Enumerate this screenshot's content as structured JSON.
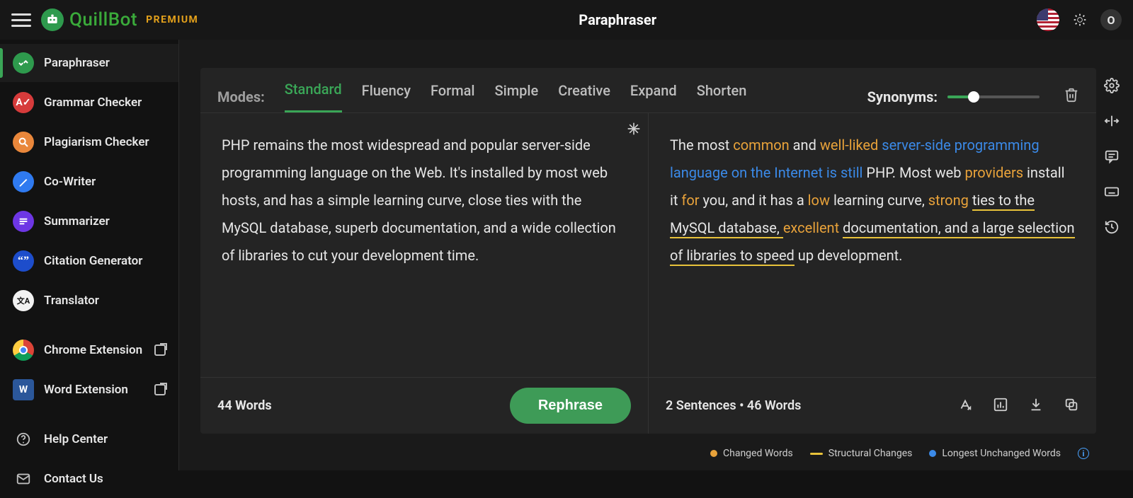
{
  "header": {
    "brand_name": "QuillBot",
    "brand_premium": "PREMIUM",
    "title": "Paraphraser",
    "avatar_letter": "O"
  },
  "sidebar": {
    "main_items": [
      {
        "id": "paraphraser",
        "label": "Paraphraser",
        "active": true
      },
      {
        "id": "grammar-checker",
        "label": "Grammar Checker",
        "active": false
      },
      {
        "id": "plagiarism-checker",
        "label": "Plagiarism Checker",
        "active": false
      },
      {
        "id": "co-writer",
        "label": "Co-Writer",
        "active": false
      },
      {
        "id": "summarizer",
        "label": "Summarizer",
        "active": false
      },
      {
        "id": "citation-generator",
        "label": "Citation Generator",
        "active": false
      },
      {
        "id": "translator",
        "label": "Translator",
        "active": false
      }
    ],
    "ext_items": [
      {
        "id": "chrome-ext",
        "label": "Chrome Extension"
      },
      {
        "id": "word-ext",
        "label": "Word Extension"
      }
    ],
    "footer_items": [
      {
        "id": "help-center",
        "label": "Help Center"
      },
      {
        "id": "contact-us",
        "label": "Contact Us"
      }
    ]
  },
  "modes": {
    "label": "Modes:",
    "items": [
      "Standard",
      "Fluency",
      "Formal",
      "Simple",
      "Creative",
      "Expand",
      "Shorten"
    ],
    "active_index": 0,
    "synonyms_label": "Synonyms:"
  },
  "input": {
    "text": "PHP remains the most widespread and popular server-side programming language on the Web. It's installed by most web hosts, and has a simple learning curve, close ties with the MySQL database, superb documentation, and a wide collection of libraries to cut your development time.",
    "word_count": "44 Words"
  },
  "output": {
    "tokens": [
      {
        "t": "The most ",
        "c": "plain"
      },
      {
        "t": "common",
        "c": "changed"
      },
      {
        "t": " and ",
        "c": "plain"
      },
      {
        "t": "well-liked",
        "c": "changed"
      },
      {
        "t": " ",
        "c": "plain"
      },
      {
        "t": "server-side programming language on the Internet is still",
        "c": "longest"
      },
      {
        "t": " PHP. Most web ",
        "c": "plain"
      },
      {
        "t": "providers",
        "c": "changed"
      },
      {
        "t": " install it ",
        "c": "plain"
      },
      {
        "t": "for",
        "c": "changed"
      },
      {
        "t": " you, and it has a ",
        "c": "plain"
      },
      {
        "t": "low",
        "c": "changed"
      },
      {
        "t": " learning curve, ",
        "c": "plain"
      },
      {
        "t": "strong",
        "c": "changed"
      },
      {
        "t": " ",
        "c": "plain"
      },
      {
        "t": "ties to the MySQL database, ",
        "c": "struct"
      },
      {
        "t": "excellent",
        "c": "changed"
      },
      {
        "t": " ",
        "c": "plain"
      },
      {
        "t": "documentation, and a ",
        "c": "struct"
      },
      {
        "t": "large selection",
        "c": "changed-struct"
      },
      {
        "t": " ",
        "c": "plain"
      },
      {
        "t": "of libraries to ",
        "c": "struct"
      },
      {
        "t": "speed",
        "c": "changed-struct"
      },
      {
        "t": " up development.",
        "c": "plain"
      }
    ],
    "stats": "2 Sentences  •  46 Words",
    "rephrase_label": "Rephrase"
  },
  "legend": {
    "changed": "Changed Words",
    "struct": "Structural Changes",
    "longest": "Longest Unchanged Words"
  }
}
